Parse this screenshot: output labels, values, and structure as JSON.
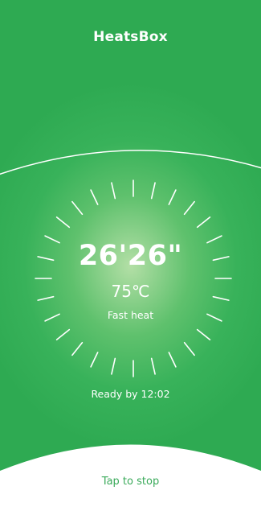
{
  "app": {
    "title": "HeatsBox"
  },
  "status": {
    "timer": "26'26\"",
    "temperature": "75℃",
    "mode": "Fast heat",
    "ready_text": "Ready by 12:02"
  },
  "actions": {
    "tap_to_stop": "Tap to stop"
  },
  "colors": {
    "accent": "#2eaa52",
    "text_on_accent": "#ffffff",
    "link_green": "#3aaa5a"
  }
}
